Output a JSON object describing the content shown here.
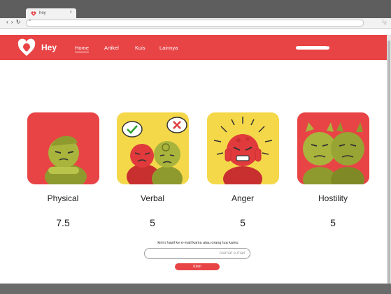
{
  "browser": {
    "tab_title": "hey",
    "tab_close": "×",
    "nav_buttons": "‹ › ↻",
    "url": "",
    "search_glyph": "⌕",
    "star_glyph": "☆",
    "menu_glyph": "⋮"
  },
  "header": {
    "brand": "Hey",
    "nav": [
      {
        "label": "Home",
        "active": true
      },
      {
        "label": "Artikel",
        "active": false
      },
      {
        "label": "Kuis",
        "active": false
      },
      {
        "label": "Lainnya",
        "active": false
      }
    ],
    "search_value": ""
  },
  "cards": [
    {
      "label": "Physical",
      "score": "7.5",
      "bg": "#e84446"
    },
    {
      "label": "Verbal",
      "score": "5",
      "bg": "#f4d84a"
    },
    {
      "label": "Anger",
      "score": "5",
      "bg": "#f4d84a"
    },
    {
      "label": "Hostility",
      "score": "5",
      "bg": "#e84446"
    }
  ],
  "email": {
    "prompt": "kirim hasil ke e-mail kamu atau orang tua kamu",
    "placeholder": "Alamat e-mail",
    "value": "",
    "send_label": "Kirim"
  },
  "colors": {
    "accent": "#e84446",
    "yellow": "#f4d84a",
    "green_character": "#a8b43c",
    "red_character": "#e03a3c"
  },
  "icons": {
    "logo": "heart-face-icon",
    "close": "close-icon",
    "search": "search-icon",
    "star": "star-icon",
    "menu": "menu-dots-icon"
  }
}
